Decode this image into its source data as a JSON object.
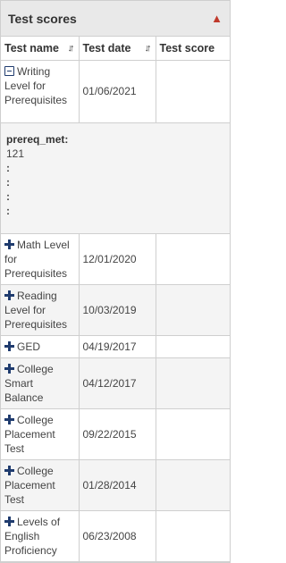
{
  "panel": {
    "title": "Test scores",
    "collapse_icon": "chevron-up-icon"
  },
  "columns": {
    "name": "Test name",
    "date": "Test date",
    "score": "Test score"
  },
  "rows": [
    {
      "name": "Writing Level for Prerequisites",
      "date": "01/06/2021",
      "score": "",
      "expanded": true
    },
    {
      "name": "Math Level for Prerequisites",
      "date": "12/01/2020",
      "score": ""
    },
    {
      "name": "Reading Level for Prerequisites",
      "date": "10/03/2019",
      "score": ""
    },
    {
      "name": "GED",
      "date": "04/19/2017",
      "score": ""
    },
    {
      "name": "College Smart Balance",
      "date": "04/12/2017",
      "score": ""
    },
    {
      "name": "College Placement Test",
      "date": "09/22/2015",
      "score": ""
    },
    {
      "name": "College Placement Test",
      "date": "01/28/2014",
      "score": ""
    },
    {
      "name": "Levels of English Proficiency",
      "date": "06/23/2008",
      "score": ""
    }
  ],
  "detail": {
    "label": "prereq_met:",
    "value": "121",
    "separators": [
      ":",
      ":",
      ":",
      ":"
    ]
  },
  "colors": {
    "accent": "#c0392b",
    "toggle": "#1f3b6e",
    "header_bg": "#e9e9e9",
    "alt_row": "#f4f4f4"
  }
}
